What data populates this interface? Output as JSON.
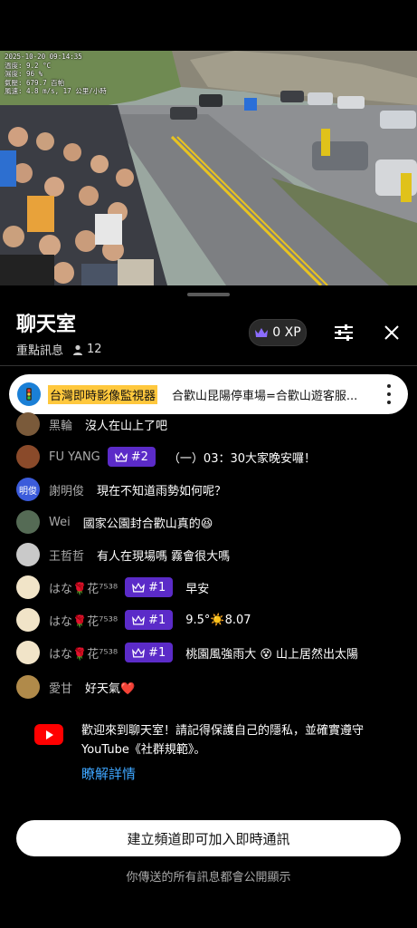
{
  "video": {
    "overlay_lines": [
      "2025-10-20 09:14:35",
      "溫度: 9.2 °C",
      "濕度: 96 %",
      "氣壓: 679.7 百帕",
      "風速: 4.8 m/s, 17 公里/小時"
    ]
  },
  "chat": {
    "title": "聊天室",
    "mode": "重點訊息",
    "viewer_count": "12",
    "xp_label": "0 XP",
    "icons": {
      "settings": "sliders-icon",
      "close": "close-icon",
      "crown": "crown-icon",
      "person": "person-icon"
    }
  },
  "pinned": {
    "author": "台灣即時影像監視器",
    "text": "合歡山昆陽停車場=合歡山遊客服..."
  },
  "messages": [
    {
      "name": "黑輪",
      "badge": "",
      "text": "沒人在山上了吧",
      "avatar_color": "#7a5a3a"
    },
    {
      "name": "FU YANG",
      "badge": "#2",
      "text": "（一）03：30大家晚安囉！",
      "avatar_color": "#8a4a2a"
    },
    {
      "name": "謝明俊",
      "badge": "",
      "text": "現在不知道雨勢如何呢？",
      "avatar_color": "#3b5bdb",
      "avatar_text": "明俊"
    },
    {
      "name": "Wei",
      "badge": "",
      "text": "國家公園封合歡山真的😆",
      "avatar_color": "#556b55"
    },
    {
      "name": "王哲哲",
      "badge": "",
      "text": "有人在現場嗎 霧會很大嗎",
      "avatar_color": "#c9c9c9"
    },
    {
      "name": "はな🌹花⁷⁵³⁸",
      "badge": "#1",
      "text": "早安",
      "avatar_color": "#f1e4c8"
    },
    {
      "name": "はな🌹花⁷⁵³⁸",
      "badge": "#1",
      "text": "9.5°☀️8.07",
      "avatar_color": "#f1e4c8"
    },
    {
      "name": "はな🌹花⁷⁵³⁸",
      "badge": "#1",
      "text": "桃園風強雨大 😵 山上居然出太陽",
      "avatar_color": "#f1e4c8"
    },
    {
      "name": "愛甘",
      "badge": "",
      "text": "好天氣❤️",
      "avatar_color": "#b08a4a"
    }
  ],
  "welcome": {
    "text": "歡迎來到聊天室！請記得保護自己的隱私，並確實遵守 YouTube《社群規範》。",
    "link": "瞭解詳情"
  },
  "join_button": "建立頻道即可加入即時通訊",
  "footer": "你傳送的所有訊息都會公開顯示",
  "colors": {
    "badge": "#5b2bc8",
    "link": "#3ea6ff",
    "pinned_author_bg": "#ffc83d",
    "youtube_red": "#ff0000"
  }
}
